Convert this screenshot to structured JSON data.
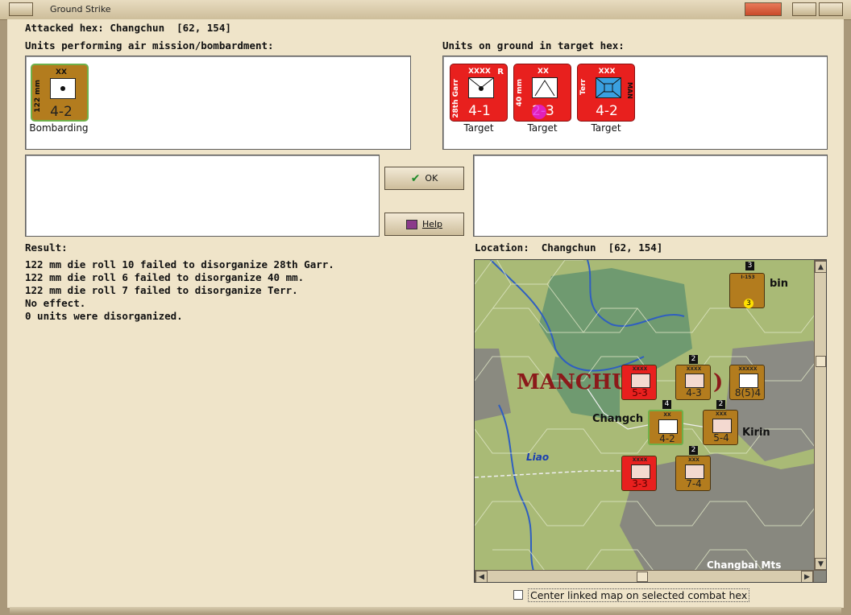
{
  "window": {
    "title": "Ground Strike"
  },
  "header": {
    "attacked_hex": "Attacked hex: Changchun  [62, 154]"
  },
  "air_units": {
    "label": "Units performing air mission/bombardment:",
    "items": [
      {
        "size": "XX",
        "side_text": "122 mm",
        "value": "4-2",
        "status": "Bombarding",
        "color": "#b37c1e"
      }
    ]
  },
  "ground_units": {
    "label": "Units on ground in target hex:",
    "items": [
      {
        "size": "XXXX",
        "side_text": "28th Garr",
        "value": "4-1",
        "flag": "R",
        "status": "Target",
        "color": "#e8201e"
      },
      {
        "size": "XX",
        "side_text": "40 mm",
        "value": "2-3",
        "status": "Target",
        "color": "#e8201e"
      },
      {
        "size": "XXX",
        "side_text": "Terr",
        "right_text": "MAN",
        "value": "4-2",
        "status": "Target",
        "color": "#e8201e"
      }
    ]
  },
  "buttons": {
    "ok": "OK",
    "help": "Help"
  },
  "result": {
    "label": "Result:",
    "lines": [
      "122 mm die roll 10 failed to disorganize 28th Garr.",
      "122 mm die roll 6 failed to disorganize 40 mm.",
      "122 mm die roll 7 failed to disorganize Terr.",
      "No effect.",
      "0 units were disorganized."
    ]
  },
  "location": {
    "label": "Location:  Changchun  [62, 154]",
    "map": {
      "region_label": "MANCHU",
      "region_label_tail": ")",
      "city_1": "Changch",
      "city_2": "Kirin",
      "city_3": "bin",
      "river": "Liao",
      "mountains": "Changbai Mts",
      "units": [
        {
          "value": "5-3",
          "size": "XXXX",
          "color": "#e8201e"
        },
        {
          "value": "4-3",
          "size": "XXXX",
          "color": "#b37c1e"
        },
        {
          "value": "8(5)4",
          "size": "XXXXX",
          "color": "#b37c1e"
        },
        {
          "value": "4-2",
          "size": "XX",
          "color": "#b37c1e"
        },
        {
          "value": "5-4",
          "size": "XXX",
          "color": "#b37c1e"
        },
        {
          "value": "3-3",
          "size": "XXXX",
          "color": "#e8201e"
        },
        {
          "value": "7-4",
          "size": "XXX",
          "color": "#b37c1e"
        },
        {
          "value": "3",
          "size": "I-153",
          "color": "#b37c1e"
        }
      ],
      "stack_counts": [
        "3",
        "2",
        "4",
        "2",
        "2"
      ]
    }
  },
  "footer": {
    "checkbox_label": "Center linked map on selected combat hex",
    "checked": false
  }
}
